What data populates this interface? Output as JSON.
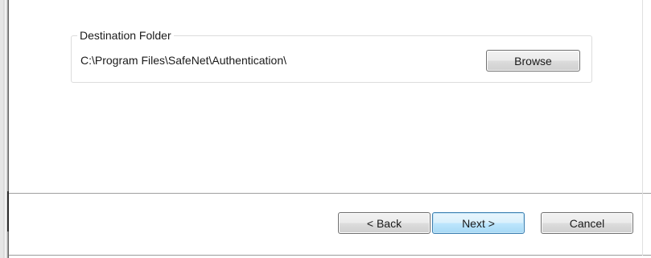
{
  "destination": {
    "group_label": "Destination Folder",
    "path": "C:\\Program Files\\SafeNet\\Authentication\\",
    "browse_label": "Browse"
  },
  "footer": {
    "back_label": "< Back",
    "next_label": "Next >",
    "cancel_label": "Cancel"
  },
  "colors": {
    "default_button_border": "#3c7fb1",
    "default_button_fill": "#bee6fd",
    "button_border": "#707070"
  }
}
